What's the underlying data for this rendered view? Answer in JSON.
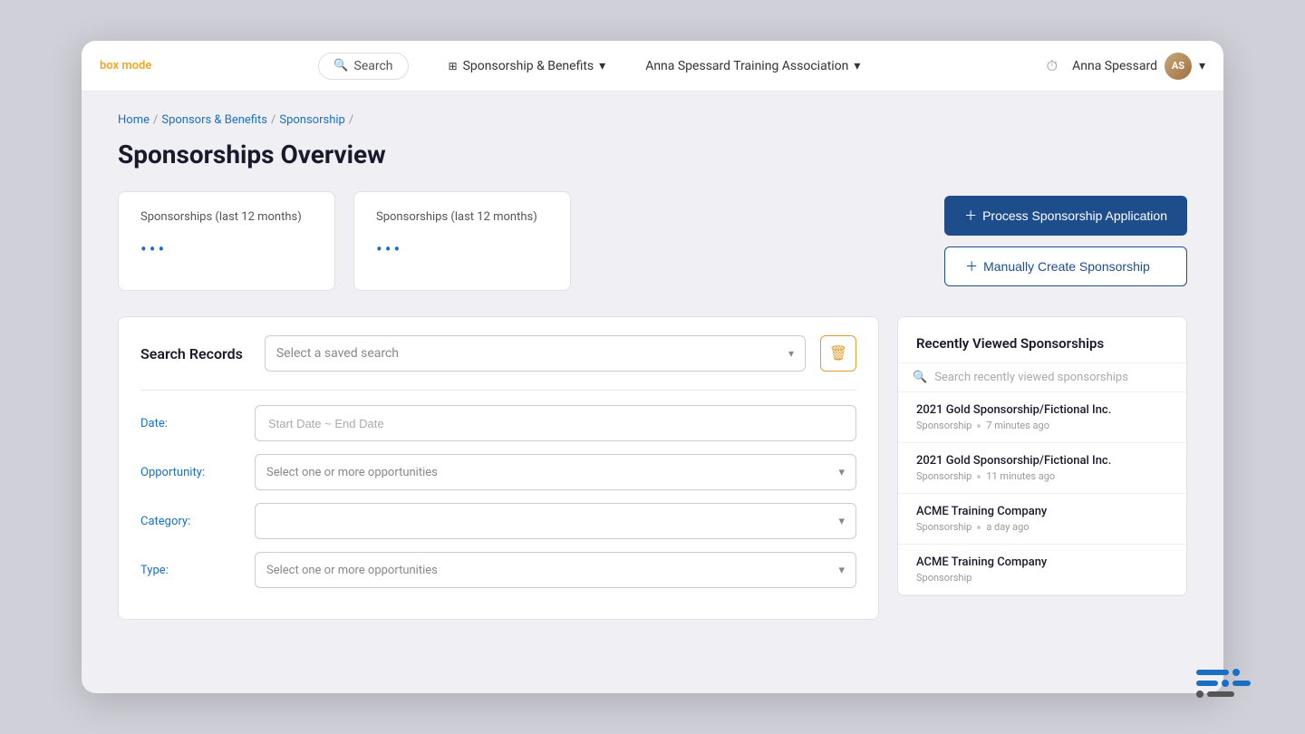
{
  "nav": {
    "sandbox_label": "box mode",
    "search_label": "Search",
    "app_name": "Sponsorship & Benefits",
    "org_name": "Anna Spessard Training Association",
    "user_name": "Anna Spessard",
    "avatar_initials": "AS"
  },
  "breadcrumb": {
    "home": "Home",
    "sponsors": "Sponsors & Benefits",
    "sponsorship": "Sponsorship"
  },
  "page": {
    "title": "Sponsorships Overview"
  },
  "stats": {
    "card1_label": "Sponsorships (last 12 months)",
    "card2_label": "Sponsorships (last 12 months)",
    "dots": "•••"
  },
  "buttons": {
    "process": "Process Sponsorship Application",
    "manual": "Manually Create Sponsorship",
    "plus": "+"
  },
  "search_panel": {
    "title": "Search Records",
    "saved_search_placeholder": "Select a saved search",
    "date_label": "Date:",
    "date_placeholder": "Start Date ~ End Date",
    "opportunity_label": "Opportunity:",
    "opportunity_placeholder": "Select one or more opportunities",
    "category_label": "Category:",
    "category_placeholder": "",
    "type_label": "Type:",
    "type_placeholder": "Select one or more opportunities"
  },
  "recent_panel": {
    "title": "Recently Viewed Sponsorships",
    "search_placeholder": "Search recently viewed sponsorships",
    "items": [
      {
        "name": "2021 Gold Sponsorship/Fictional Inc.",
        "type": "Sponsorship",
        "time": "7 minutes ago"
      },
      {
        "name": "2021 Gold Sponsorship/Fictional Inc.",
        "type": "Sponsorship",
        "time": "11 minutes ago"
      },
      {
        "name": "ACME Training Company",
        "type": "Sponsorship",
        "time": "a day ago"
      },
      {
        "name": "ACME Training Company",
        "type": "Sponsorship",
        "time": ""
      }
    ]
  }
}
